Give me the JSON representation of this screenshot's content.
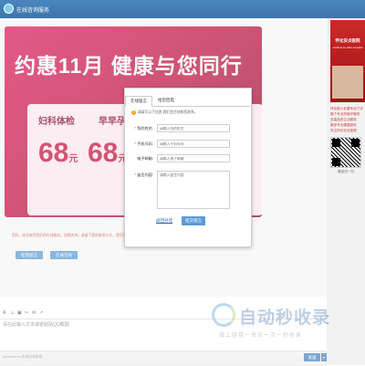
{
  "window": {
    "title": "在线咨询服务"
  },
  "banner": {
    "headline": "约惠11月 健康与您同行",
    "items": [
      {
        "name": "妇科体检",
        "price": "68",
        "unit": "元"
      },
      {
        "name": "早早孕检测",
        "price": "68",
        "unit": "元"
      }
    ]
  },
  "sidebar": {
    "hospital_name": "怀化安贞医院",
    "hospital_subtitle": "Huaihua An Zhen Hospital",
    "links": [
      "怀化新人乳腺专业门诊",
      "做个专业的医疗服务",
      "至高品质生活服务",
      "服务专业康复服务",
      "关注怀化安贞医院"
    ],
    "qr_caption": "微信扫一扫"
  },
  "notice": {
    "text": "您好，欢迎来到我们的在线服务。如需咨询，请留下您的联系方式，我们将尽快与您联系。",
    "buttons": [
      "给我留言",
      "在线咨询"
    ]
  },
  "toolbar": {
    "icons": [
      "A",
      "☺",
      "▣",
      "✂",
      "✉",
      "↗"
    ]
  },
  "input": {
    "placeholder": "请在此输入文本或者粘贴QQ截图"
  },
  "watermark": {
    "title": "自动秒收录",
    "subtitle": "做上链接一来访一次一秒收录"
  },
  "footer": {
    "powered": "powered by 在线咨询系统",
    "send_label": "发送",
    "send_arrow": "▾"
  },
  "modal": {
    "tabs": [
      "在线留言",
      "给您回电"
    ],
    "tip": "请填写以下信息,我们会尽快和您联系。",
    "fields": [
      {
        "label": "您的姓名:",
        "required": true,
        "placeholder": "请输入您的姓名"
      },
      {
        "label": "手机号码:",
        "required": true,
        "placeholder": "请输入手机号码"
      },
      {
        "label": "电子邮箱:",
        "required": false,
        "placeholder": "请输入电子邮箱"
      },
      {
        "label": "留言内容:",
        "required": true,
        "placeholder": "请输入留言内容"
      }
    ],
    "back_label": "返回对话",
    "submit_label": "提交留言"
  }
}
